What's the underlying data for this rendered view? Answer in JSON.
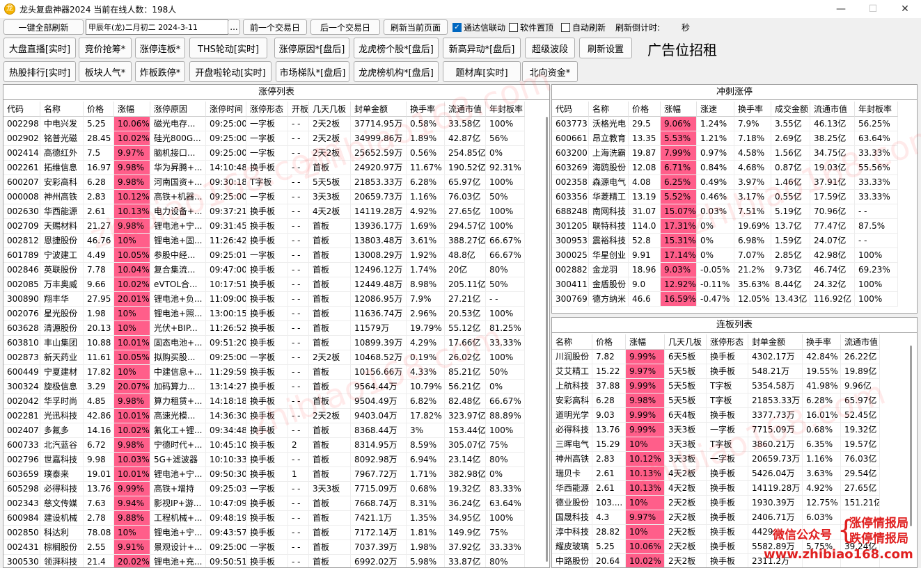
{
  "window": {
    "title": "龙头复盘神器2024 当前在线人数：198人",
    "app_icon": "龙",
    "minimize": "—",
    "maximize": "☐",
    "close": "✕"
  },
  "toolbar": {
    "refresh_all": "一键全部刷新",
    "date_value": "甲辰年(龙)二月初二  2024-3-11",
    "date_picker": "...",
    "prev_day": "前一个交易日",
    "next_day": "后一个交易日",
    "refresh_page": "刷新当前页面",
    "tdx_link": "通达信联动",
    "pin_top": "软件置顶",
    "auto_refresh": "自动刷新",
    "countdown_label": "刷新倒计时:",
    "countdown_unit": "秒",
    "tdx_link_checked": true,
    "pin_top_checked": false,
    "auto_refresh_checked": false
  },
  "nav": {
    "row1": [
      "大盘直播[实时]",
      "竞价抢筹*",
      "涨停连板*",
      "THS轮动[实时]",
      "涨停原因*[盘后]",
      "龙虎榜个股*[盘后]",
      "新高异动*[盘后]",
      "超级波段",
      "刷新设置"
    ],
    "row2": [
      "热股排行[实时]",
      "板块人气*",
      "炸板跌停*",
      "开盘啦轮动[实时]",
      "市场梯队*[盘后]",
      "龙虎榜机构*[盘后]",
      "题材库[实时]",
      "北向资金*"
    ],
    "ad": "广告位招租"
  },
  "limit_up": {
    "title": "涨停列表",
    "headers": [
      "代码",
      "名称",
      "价格",
      "涨幅",
      "涨停原因",
      "涨停时间",
      "涨停形态",
      "开板",
      "几天几板",
      "封单金额",
      "换手率",
      "流通市值",
      "年封板率"
    ],
    "rows": [
      [
        "002298",
        "中电兴发",
        "5.25",
        "10.06%",
        "磁光电存...",
        "09:25:00",
        "一字板",
        "- -",
        "2天2板",
        "37714.95万",
        "0.58%",
        "33.58亿",
        "100%"
      ],
      [
        "002902",
        "铭普光磁",
        "28.45",
        "10.02%",
        "硅光800G...",
        "09:25:00",
        "一字板",
        "- -",
        "2天2板",
        "34999.86万",
        "1.89%",
        "42.87亿",
        "56%"
      ],
      [
        "002414",
        "高德红外",
        "7.5",
        "9.97%",
        "脑机接口...",
        "09:25:00",
        "一字板",
        "- -",
        "2天2板",
        "25652.59万",
        "0.56%",
        "254.85亿",
        "0%"
      ],
      [
        "002261",
        "拓维信息",
        "16.97",
        "9.98%",
        "华为昇腾+...",
        "14:10:48",
        "换手板",
        "- -",
        "首板",
        "24920.97万",
        "11.67%",
        "190.52亿",
        "92.31%"
      ],
      [
        "600207",
        "安彩高科",
        "6.28",
        "9.98%",
        "河南国资+...",
        "09:30:18",
        "T字板",
        "- -",
        "5天5板",
        "21853.33万",
        "6.28%",
        "65.97亿",
        "100%"
      ],
      [
        "000008",
        "神州高铁",
        "2.83",
        "10.12%",
        "高铁+机器...",
        "09:25:00",
        "一字板",
        "- -",
        "3天3板",
        "20659.73万",
        "1.16%",
        "76.03亿",
        "50%"
      ],
      [
        "002630",
        "华西能源",
        "2.61",
        "10.13%",
        "电力设备+...",
        "09:37:21",
        "换手板",
        "- -",
        "4天2板",
        "14119.28万",
        "4.92%",
        "27.65亿",
        "100%"
      ],
      [
        "002709",
        "天赐材料",
        "21.27",
        "9.98%",
        "锂电池+宁...",
        "09:31:45",
        "换手板",
        "- -",
        "首板",
        "13936.17万",
        "1.69%",
        "294.57亿",
        "100%"
      ],
      [
        "002812",
        "恩捷股份",
        "46.76",
        "10%",
        "锂电池+固...",
        "11:26:42",
        "换手板",
        "- -",
        "首板",
        "13803.48万",
        "3.61%",
        "388.27亿",
        "66.67%"
      ],
      [
        "601789",
        "宁波建工",
        "4.49",
        "10.05%",
        "参股中经...",
        "09:25:01",
        "一字板",
        "- -",
        "首板",
        "13008.29万",
        "1.92%",
        "48.8亿",
        "66.67%"
      ],
      [
        "002846",
        "英联股份",
        "7.78",
        "10.04%",
        "复合集流...",
        "09:47:00",
        "换手板",
        "- -",
        "首板",
        "12496.12万",
        "1.74%",
        "20亿",
        "80%"
      ],
      [
        "002085",
        "万丰奥威",
        "9.66",
        "10.02%",
        "eVTOL合...",
        "10:17:51",
        "换手板",
        "- -",
        "首板",
        "12449.48万",
        "8.98%",
        "205.11亿",
        "50%"
      ],
      [
        "300890",
        "翔丰华",
        "27.95",
        "20.01%",
        "锂电池+负...",
        "11:09:00",
        "换手板",
        "- -",
        "首板",
        "12086.95万",
        "7.9%",
        "27.21亿",
        "- -"
      ],
      [
        "002076",
        "星光股份",
        "1.98",
        "10%",
        "锂电池+照...",
        "13:00:15",
        "换手板",
        "- -",
        "首板",
        "11636.74万",
        "2.96%",
        "20.53亿",
        "100%"
      ],
      [
        "603628",
        "清源股份",
        "20.13",
        "10%",
        "光伏+BIP...",
        "11:26:52",
        "换手板",
        "- -",
        "首板",
        "11579万",
        "19.79%",
        "55.12亿",
        "81.25%"
      ],
      [
        "603810",
        "丰山集团",
        "10.88",
        "10.01%",
        "固态电池+...",
        "09:51:20",
        "换手板",
        "- -",
        "首板",
        "10899.39万",
        "4.29%",
        "17.66亿",
        "33.33%"
      ],
      [
        "002873",
        "新天药业",
        "11.61",
        "10.05%",
        "拟购买股...",
        "09:25:00",
        "一字板",
        "- -",
        "2天2板",
        "10468.52万",
        "0.19%",
        "26.02亿",
        "100%"
      ],
      [
        "600449",
        "宁夏建材",
        "17.82",
        "10%",
        "中建信息+...",
        "11:29:59",
        "换手板",
        "- -",
        "首板",
        "10156.66万",
        "4.33%",
        "85.21亿",
        "50%"
      ],
      [
        "300324",
        "旋极信息",
        "3.29",
        "20.07%",
        "加码算力...",
        "13:14:27",
        "换手板",
        "- -",
        "首板",
        "9564.44万",
        "10.79%",
        "56.21亿",
        "0%"
      ],
      [
        "002042",
        "华孚时尚",
        "4.85",
        "9.98%",
        "算力租赁+...",
        "14:18:18",
        "换手板",
        "- -",
        "首板",
        "9504.49万",
        "6.82%",
        "82.48亿",
        "66.67%"
      ],
      [
        "002281",
        "光迅科技",
        "42.86",
        "10.01%",
        "高速光模...",
        "14:36:30",
        "换手板",
        "- -",
        "2天2板",
        "9403.04万",
        "17.82%",
        "323.97亿",
        "88.89%"
      ],
      [
        "002407",
        "多氟多",
        "14.16",
        "10.02%",
        "氟化工+锂...",
        "09:34:48",
        "换手板",
        "- -",
        "首板",
        "8368.44万",
        "3%",
        "153.44亿",
        "100%"
      ],
      [
        "600733",
        "北汽蓝谷",
        "6.72",
        "9.98%",
        "宁德时代+...",
        "10:45:10",
        "换手板",
        "2",
        "首板",
        "8314.95万",
        "8.59%",
        "305.07亿",
        "75%"
      ],
      [
        "002796",
        "世嘉科技",
        "9.98",
        "10.03%",
        "5G+滤波器",
        "10:10:33",
        "换手板",
        "- -",
        "首板",
        "8092.98万",
        "6.94%",
        "23.14亿",
        "80%"
      ],
      [
        "603659",
        "璞泰来",
        "19.01",
        "10.01%",
        "锂电池+宁...",
        "09:50:30",
        "换手板",
        "1",
        "首板",
        "7967.72万",
        "1.71%",
        "382.98亿",
        "0%"
      ],
      [
        "605298",
        "必得科技",
        "13.76",
        "9.99%",
        "高铁+增持",
        "09:25:03",
        "一字板",
        "- -",
        "3天3板",
        "7715.09万",
        "0.68%",
        "19.32亿",
        "83.33%"
      ],
      [
        "002343",
        "慈文传媒",
        "7.63",
        "9.94%",
        "影视IP+游...",
        "10:47:09",
        "换手板",
        "- -",
        "首板",
        "7668.74万",
        "8.31%",
        "36.24亿",
        "63.64%"
      ],
      [
        "600984",
        "建设机械",
        "2.78",
        "9.88%",
        "工程机械+...",
        "09:48:19",
        "换手板",
        "- -",
        "首板",
        "7421.1万",
        "1.35%",
        "34.95亿",
        "100%"
      ],
      [
        "002850",
        "科达利",
        "78.08",
        "10%",
        "锂电池+宁...",
        "09:43:57",
        "换手板",
        "- -",
        "首板",
        "7172.14万",
        "1.81%",
        "149.9亿",
        "75%"
      ],
      [
        "002431",
        "棕榈股份",
        "2.55",
        "9.91%",
        "景观设计+...",
        "09:25:00",
        "一字板",
        "- -",
        "首板",
        "7037.39万",
        "1.98%",
        "37.92亿",
        "33.33%"
      ],
      [
        "300530",
        "领湃科技",
        "21.4",
        "20.02%",
        "锂电池+充...",
        "09:50:51",
        "换手板",
        "- -",
        "首板",
        "6992.02万",
        "5.98%",
        "33.87亿",
        "80%"
      ]
    ]
  },
  "rush": {
    "title": "冲刺涨停",
    "headers": [
      "代码",
      "名称",
      "价格",
      "涨幅",
      "涨速",
      "换手率",
      "成交金额",
      "流通市值",
      "年封板率"
    ],
    "rows": [
      [
        "603773",
        "沃格光电",
        "29.5",
        "9.06%",
        "1.24%",
        "7.9%",
        "3.55亿",
        "46.13亿",
        "56.25%"
      ],
      [
        "600661",
        "昂立教育",
        "13.35",
        "5.53%",
        "1.21%",
        "7.18%",
        "2.69亿",
        "38.25亿",
        "63.64%"
      ],
      [
        "603200",
        "上海洗霸",
        "19.87",
        "7.99%",
        "0.97%",
        "4.58%",
        "1.56亿",
        "34.75亿",
        "33.33%"
      ],
      [
        "603269",
        "海鸥股份",
        "12.08",
        "6.71%",
        "0.84%",
        "4.68%",
        "0.87亿",
        "19.03亿",
        "55.56%"
      ],
      [
        "002358",
        "森源电气",
        "4.08",
        "6.25%",
        "0.49%",
        "3.97%",
        "1.46亿",
        "37.91亿",
        "33.33%"
      ],
      [
        "603356",
        "华菱精工",
        "13.19",
        "5.52%",
        "0.46%",
        "3.17%",
        "0.55亿",
        "17.59亿",
        "33.33%"
      ],
      [
        "688248",
        "南网科技",
        "31.07",
        "15.07%",
        "0.03%",
        "7.51%",
        "5.19亿",
        "70.96亿",
        "- -"
      ],
      [
        "301205",
        "联特科技",
        "114.0",
        "17.31%",
        "0%",
        "19.69%",
        "13.7亿",
        "77.47亿",
        "87.5%"
      ],
      [
        "300953",
        "震裕科技",
        "52.8",
        "15.31%",
        "0%",
        "6.98%",
        "1.59亿",
        "24.07亿",
        "- -"
      ],
      [
        "300025",
        "华星创业",
        "9.91",
        "17.14%",
        "0%",
        "7.07%",
        "2.85亿",
        "42.98亿",
        "100%"
      ],
      [
        "002882",
        "金龙羽",
        "18.96",
        "9.03%",
        "-0.05%",
        "21.2%",
        "9.73亿",
        "46.74亿",
        "69.23%"
      ],
      [
        "300411",
        "金盾股份",
        "9.0",
        "12.92%",
        "-0.11%",
        "35.63%",
        "8.44亿",
        "24.32亿",
        "100%"
      ],
      [
        "300769",
        "德方纳米",
        "46.6",
        "16.59%",
        "-0.47%",
        "12.05%",
        "13.43亿",
        "116.92亿",
        "100%"
      ]
    ]
  },
  "consecutive": {
    "title": "连板列表",
    "headers": [
      "名称",
      "价格",
      "涨幅",
      "几天几板",
      "涨停形态",
      "封单金额",
      "换手率",
      "流通市值"
    ],
    "rows": [
      [
        "川润股份",
        "7.82",
        "9.99%",
        "6天5板",
        "换手板",
        "4302.17万",
        "42.84%",
        "26.22亿"
      ],
      [
        "艾艾精工",
        "15.22",
        "9.97%",
        "5天5板",
        "换手板",
        "548.21万",
        "19.55%",
        "19.89亿"
      ],
      [
        "上航科技",
        "37.88",
        "9.99%",
        "5天5板",
        "T字板",
        "5354.58万",
        "41.98%",
        "9.96亿"
      ],
      [
        "安彩高科",
        "6.28",
        "9.98%",
        "5天5板",
        "T字板",
        "21853.33万",
        "6.28%",
        "65.97亿"
      ],
      [
        "道明光学",
        "9.03",
        "9.99%",
        "6天4板",
        "换手板",
        "3377.73万",
        "16.01%",
        "52.45亿"
      ],
      [
        "必得科技",
        "13.76",
        "9.99%",
        "3天3板",
        "一字板",
        "7715.09万",
        "0.68%",
        "19.32亿"
      ],
      [
        "三晖电气",
        "15.29",
        "10%",
        "3天3板",
        "T字板",
        "3860.21万",
        "6.35%",
        "19.57亿"
      ],
      [
        "神州高铁",
        "2.83",
        "10.12%",
        "3天3板",
        "一字板",
        "20659.73万",
        "1.16%",
        "76.03亿"
      ],
      [
        "瑞贝卡",
        "2.61",
        "10.13%",
        "4天2板",
        "换手板",
        "5426.04万",
        "3.63%",
        "29.54亿"
      ],
      [
        "华西能源",
        "2.61",
        "10.13%",
        "4天2板",
        "换手板",
        "14119.28万",
        "4.92%",
        "27.65亿"
      ],
      [
        "德业股份",
        "103....",
        "10%",
        "2天2板",
        "换手板",
        "1930.39万",
        "12.75%",
        "151.21亿"
      ],
      [
        "国晟科技",
        "4.3",
        "9.97%",
        "2天2板",
        "换手板",
        "2406.71万",
        "6.03%",
        ""
      ],
      [
        "淳中科技",
        "28.82",
        "10%",
        "2天2板",
        "换手板",
        "4429.",
        "",
        ""
      ],
      [
        "耀皮玻璃",
        "5.25",
        "10.06%",
        "2天2板",
        "换手板",
        "5582.89万",
        "5.75%",
        "39.24亿"
      ],
      [
        "中路股份",
        "20.64",
        "10.02%",
        "2天2板",
        "换手板",
        "2311.2万",
        "",
        ""
      ]
    ]
  },
  "promo": {
    "wechat": "微信公众号",
    "lines": [
      "涨停情报局",
      "跌停情报局"
    ],
    "site": "www.zhibiao168.com"
  },
  "watermark": "zhibiao168.com"
}
